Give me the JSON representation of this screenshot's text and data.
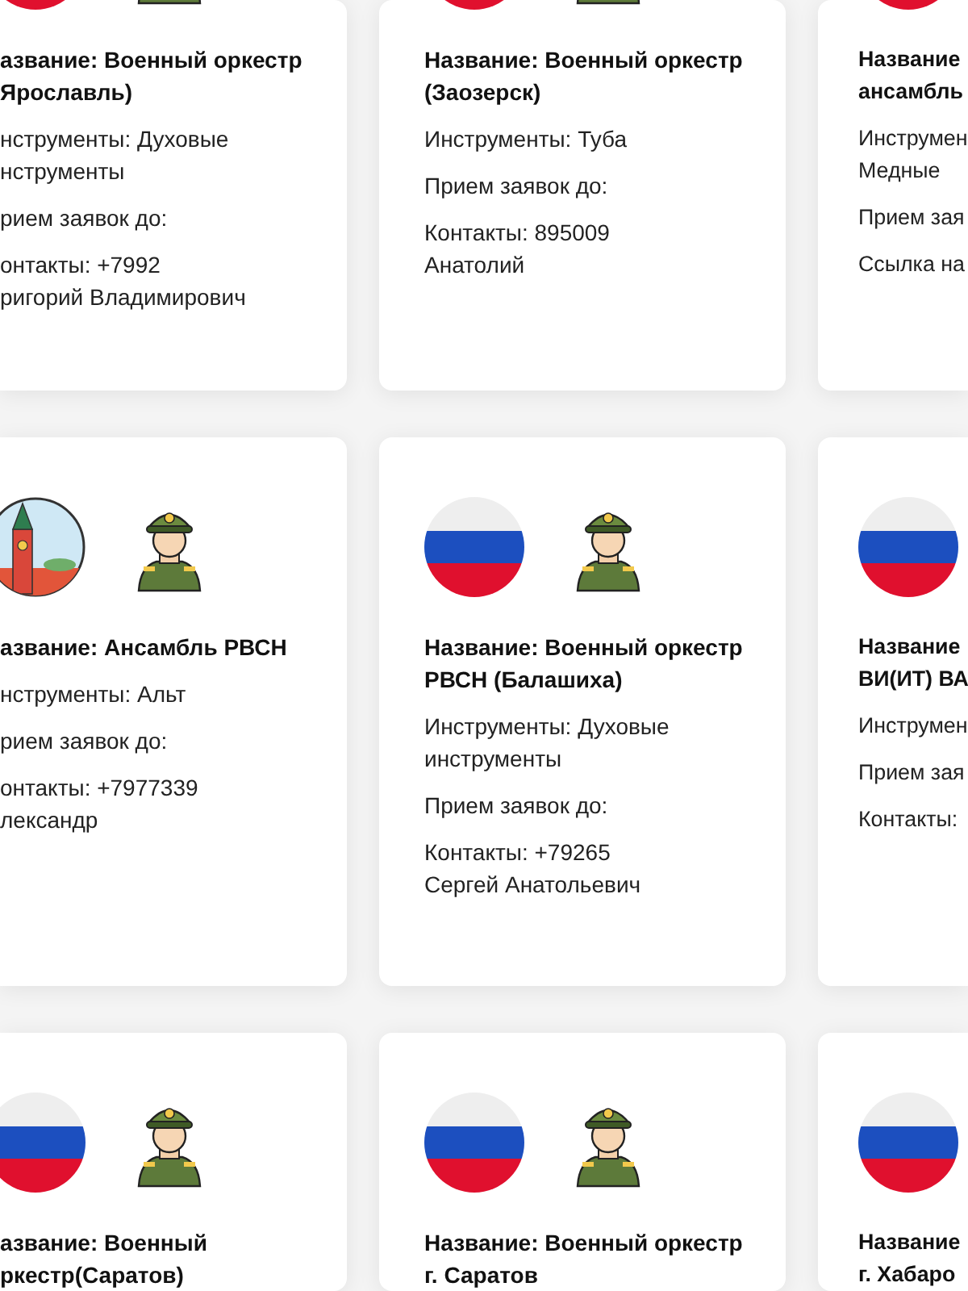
{
  "rows": [
    {
      "cards": [
        {
          "kind": "flag",
          "title": [
            "азвание: Военный оркестр",
            "Ярославль)"
          ],
          "info": [
            [
              "нструменты: Духовые",
              "нструменты"
            ],
            [
              "рием заявок до:"
            ],
            [
              "онтакты: +7992",
              "ригорий Владимирович"
            ]
          ]
        },
        {
          "kind": "flag",
          "title": [
            "Название: Военный оркестр",
            "(Заозерск)"
          ],
          "info": [
            [
              "Инструменты: Туба"
            ],
            [
              "Прием заявок до:"
            ],
            [
              "Контакты: 895009",
              "Анатолий"
            ]
          ]
        },
        {
          "kind": "flag",
          "title": [
            "Название",
            "ансамбль"
          ],
          "info": [
            [
              "Инструмен",
              "Медные"
            ],
            [
              "Прием зая"
            ],
            [
              "Ссылка на"
            ]
          ]
        }
      ]
    },
    {
      "cards": [
        {
          "kind": "kremlin",
          "title": [
            "азвание: Ансамбль РВСН"
          ],
          "info": [
            [
              "нструменты: Альт"
            ],
            [
              "рием заявок до:"
            ],
            [
              "онтакты: +7977339",
              "лександр"
            ]
          ]
        },
        {
          "kind": "flag",
          "title": [
            "Название: Военный оркестр",
            "РВСН (Балашиха)"
          ],
          "info": [
            [
              "Инструменты: Духовые",
              "инструменты"
            ],
            [
              "Прием заявок до:"
            ],
            [
              "Контакты: +79265",
              "Сергей Анатольевич"
            ]
          ]
        },
        {
          "kind": "flag",
          "title": [
            "Название",
            "ВИ(ИТ) ВА"
          ],
          "info": [
            [
              "Инструмен"
            ],
            [
              "Прием зая"
            ],
            [
              "Контакты:"
            ]
          ]
        }
      ]
    },
    {
      "cards": [
        {
          "kind": "flag",
          "title": [
            "азвание: Военный",
            "ркестр(Саратов)"
          ]
        },
        {
          "kind": "flag",
          "title": [
            "Название: Военный оркестр",
            "г. Саратов"
          ]
        },
        {
          "kind": "flag",
          "title": [
            "Название",
            "г. Хабаро"
          ]
        }
      ]
    }
  ]
}
